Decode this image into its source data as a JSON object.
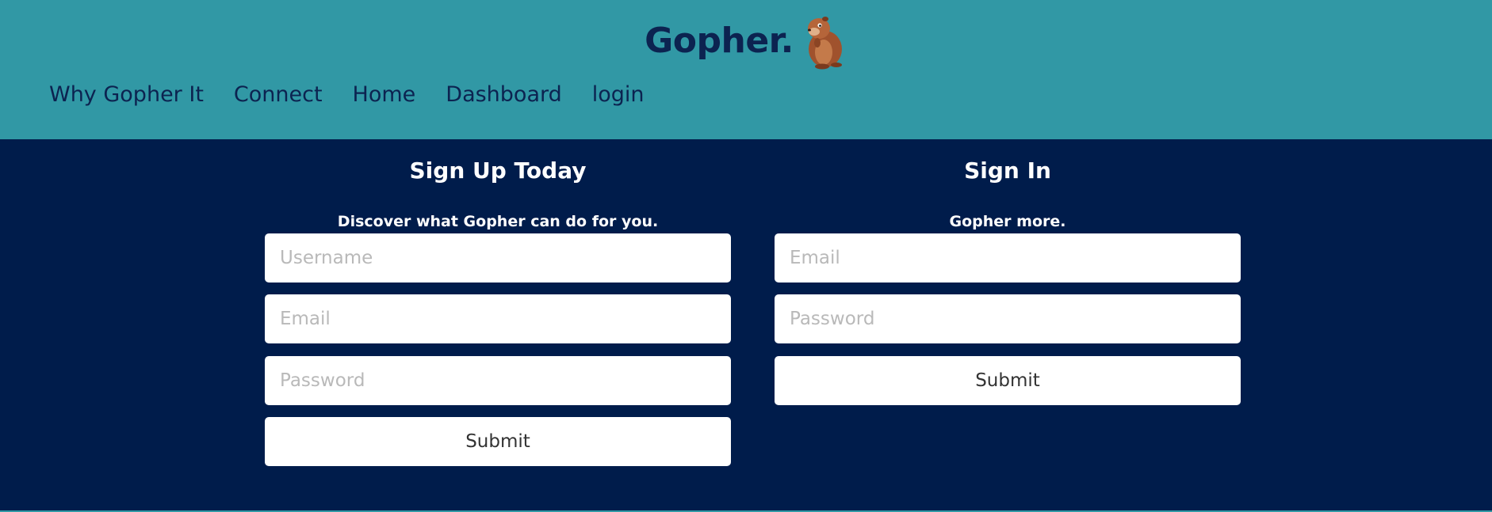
{
  "brand": {
    "title": "Gopher."
  },
  "nav": {
    "items": [
      {
        "label": "Why Gopher It"
      },
      {
        "label": "Connect"
      },
      {
        "label": "Home"
      },
      {
        "label": "Dashboard"
      },
      {
        "label": "login"
      }
    ]
  },
  "signup": {
    "title": "Sign Up Today",
    "subtitle": "Discover what Gopher can do for you.",
    "username_placeholder": "Username",
    "email_placeholder": "Email",
    "password_placeholder": "Password",
    "submit_label": "Submit"
  },
  "signin": {
    "title": "Sign In",
    "subtitle": "Gopher more.",
    "email_placeholder": "Email",
    "password_placeholder": "Password",
    "submit_label": "Submit"
  },
  "colors": {
    "header_bg": "#3198a5",
    "main_bg": "#001c4b",
    "brand_text": "#0c2350"
  },
  "icons": {
    "mascot": "gopher-icon"
  }
}
